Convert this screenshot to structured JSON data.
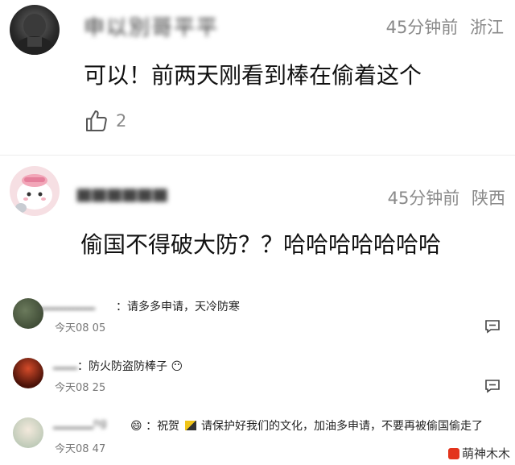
{
  "comments": [
    {
      "username": "申以別哥平平",
      "time": "45分钟前",
      "location": "浙江",
      "text": "可以！前两天刚看到棒在偷着这个",
      "likes": "2"
    },
    {
      "username": "▅▅▅▅▅▅",
      "time": "45分钟前",
      "location": "陕西",
      "text": "偷国不得破大防？？哈哈哈哈哈哈哈"
    }
  ],
  "replies": [
    {
      "username": "▁▁▁▁▁▁▁",
      "text": "请多多申请，天冷防寒",
      "time": "今天08 05"
    },
    {
      "username": "▁▁▁",
      "text": "防火防盗防棒子",
      "emoji": "😶",
      "time": "今天08 25"
    },
    {
      "username": "▁▁▁▁▁ng",
      "prefix_emoji": "😄",
      "text_a": "祝贺",
      "text_b": "请保护好我们的文化，加油多申请，不要再被偷国偷走了",
      "time": "今天08 47"
    }
  ],
  "watermark": "萌神木木",
  "colors": {
    "meta": "#8a8a8a",
    "divider": "#ececec",
    "watermark_logo": "#e3341c"
  },
  "icons": [
    "thumbs-up-icon",
    "reply-icon"
  ]
}
